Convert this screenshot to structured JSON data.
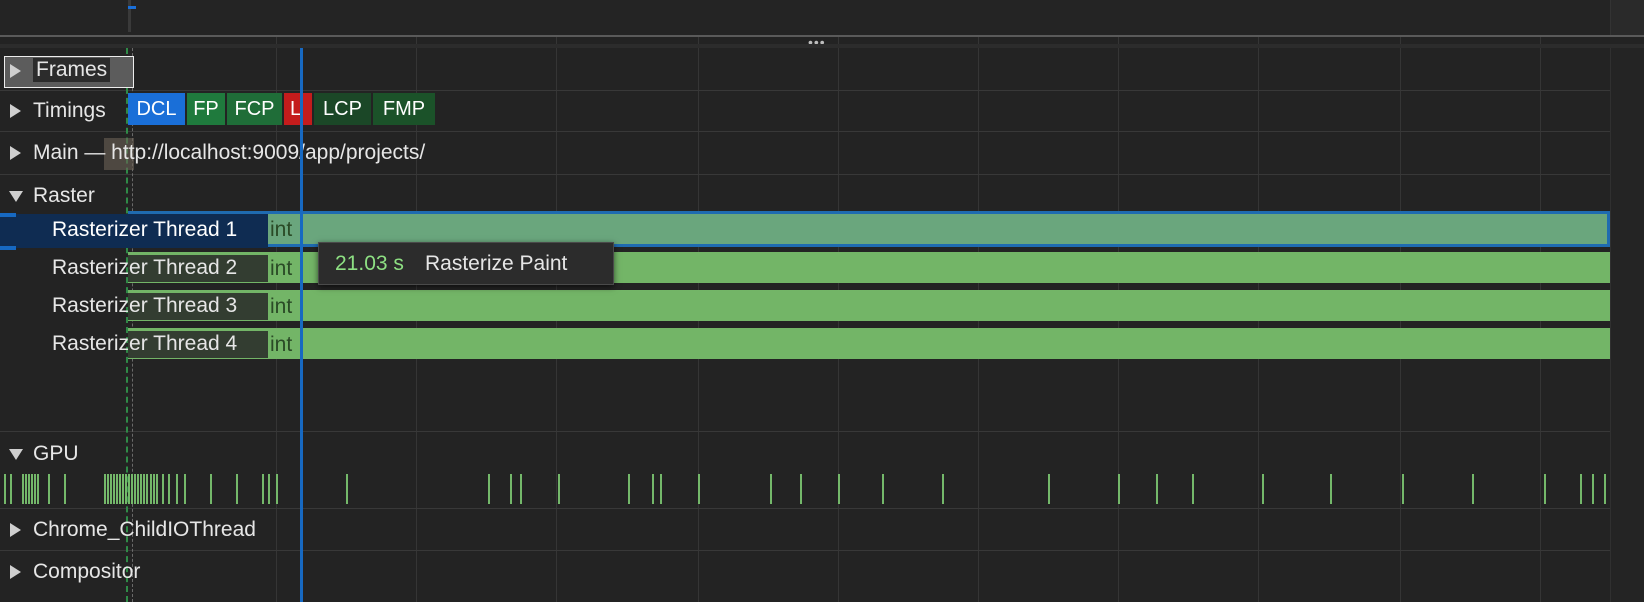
{
  "tracks": {
    "frames": "Frames",
    "timings": "Timings",
    "main": "Main — http://localhost:9009/app/projects/",
    "raster": "Raster",
    "gpu": "GPU",
    "chrome_child_io": "Chrome_ChildIOThread",
    "compositor": "Compositor"
  },
  "raster_threads": [
    "Rasterizer Thread 1",
    "Rasterizer Thread 2",
    "Rasterizer Thread 3",
    "Rasterizer Thread 4"
  ],
  "raster_bar_fragment": "int",
  "timing_markers": [
    {
      "label": "DCL",
      "color": "#1a6fd8"
    },
    {
      "label": "FP",
      "color": "#1f7a3d"
    },
    {
      "label": "FCP",
      "color": "#1f6d38"
    },
    {
      "label": "L",
      "color": "#c41c1c"
    },
    {
      "label": "LCP",
      "color": "#1b4727"
    },
    {
      "label": "FMP",
      "color": "#1b5229"
    }
  ],
  "tooltip": {
    "duration": "21.03 s",
    "title": "Rasterize Paint"
  },
  "colors": {
    "background": "#232323",
    "raster_bar": "#73b567",
    "selected_bar": "#6aa67d",
    "cursor_line": "#1769c2",
    "tooltip_duration": "#8ee083"
  },
  "resize_handle_icon": "ellipsis-icon"
}
